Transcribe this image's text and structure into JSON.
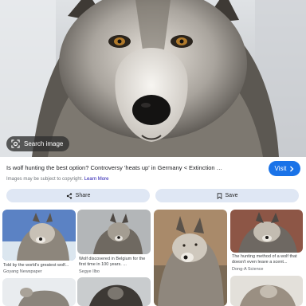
{
  "hero": {
    "search_image_label": "Search image",
    "image_alt": "Gray wolf close-up"
  },
  "result": {
    "title": "Is wolf hunting the best option? Controversy 'heats up' in Germany < Extinction News < Extinction ...",
    "copyright_text": "Images may be subject to copyright.",
    "learn_more": "Learn More",
    "visit_label": "Visit"
  },
  "actions": {
    "share_label": "Share",
    "save_label": "Save"
  },
  "related": [
    {
      "caption": "Told by the world's greatest wolf...",
      "source": "Goyang Newspaper"
    },
    {
      "caption": "Wolf discovered in Belgium for the first time in 100 years. ...",
      "source": "Segye Ilbo"
    },
    {
      "caption": "",
      "source": ""
    },
    {
      "caption": "The hunting method of a wolf that doesn't even leave a scent...",
      "source": "Dong-A Science"
    }
  ],
  "colors": {
    "accent": "#1a73e8",
    "action_bg": "#dfe7f4",
    "pill_bg": "#303030"
  }
}
